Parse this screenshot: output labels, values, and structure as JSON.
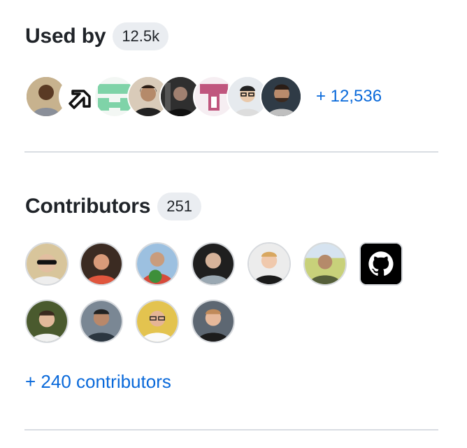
{
  "used_by": {
    "title": "Used by",
    "count": "12.5k",
    "more_link": "+ 12,536",
    "avatars": [
      {
        "icon": "person-avatar",
        "bg": "#9a7a58"
      },
      {
        "icon": "arrow-app-logo",
        "bg": "#ffffff"
      },
      {
        "icon": "green-logo",
        "bg": "#ffffff"
      },
      {
        "icon": "person-avatar",
        "bg": "#c9b9a8"
      },
      {
        "icon": "person-avatar",
        "bg": "#3c3c3c"
      },
      {
        "icon": "pink-t-logo",
        "bg": "#ffffff"
      },
      {
        "icon": "person-avatar",
        "bg": "#dfe3e8"
      },
      {
        "icon": "person-avatar",
        "bg": "#2e3a45"
      }
    ]
  },
  "contributors": {
    "title": "Contributors",
    "count": "251",
    "more_link": "+ 240 contributors",
    "avatars": [
      {
        "icon": "person-avatar",
        "bg": "#d8c59b"
      },
      {
        "icon": "person-avatar",
        "bg": "#b05a3c"
      },
      {
        "icon": "person-avatar",
        "bg": "#6f9d4a"
      },
      {
        "icon": "person-avatar",
        "bg": "#1e1e1e"
      },
      {
        "icon": "person-avatar",
        "bg": "#e8e8e8"
      },
      {
        "icon": "person-avatar",
        "bg": "#b8c56e"
      },
      {
        "icon": "github-icon",
        "bg": "#000000"
      },
      {
        "icon": "person-avatar",
        "bg": "#5c6b3a"
      },
      {
        "icon": "person-avatar",
        "bg": "#6f7c88"
      },
      {
        "icon": "person-avatar",
        "bg": "#e3c34f"
      },
      {
        "icon": "person-avatar",
        "bg": "#5d6772"
      }
    ]
  }
}
